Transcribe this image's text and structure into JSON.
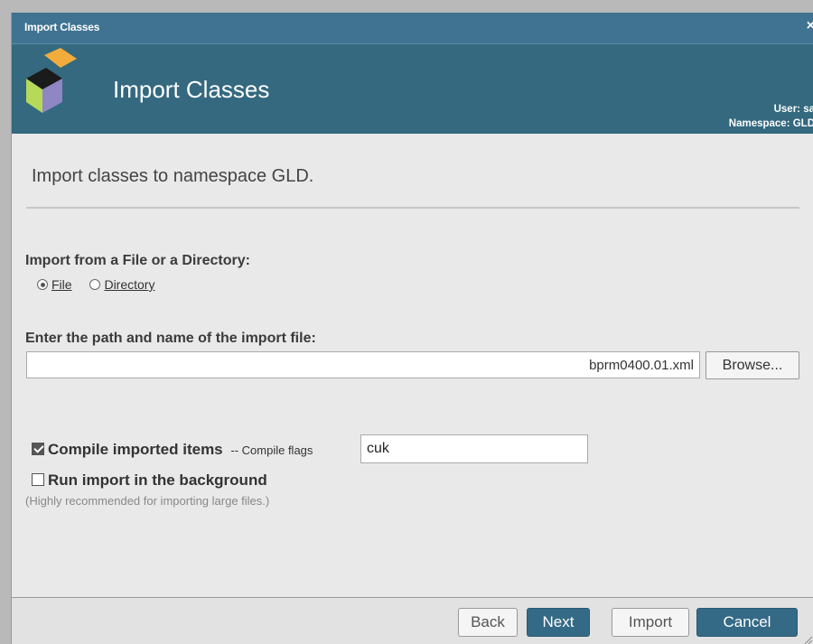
{
  "window": {
    "title": "Import Classes",
    "close_glyph": "×"
  },
  "header": {
    "heading": "Import Classes",
    "user_line": "User:  sa",
    "namespace_line": "Namespace: GLD",
    "logo_icon": "cube-logo-icon"
  },
  "intro": "Import classes to namespace GLD.",
  "source": {
    "label": "Import from a File or a Directory:",
    "options": [
      {
        "label": "File",
        "checked": true
      },
      {
        "label": "Directory",
        "checked": false
      }
    ]
  },
  "path": {
    "label": "Enter the path and name of the import file:",
    "value": "bprm0400.01.xml",
    "browse_label": "Browse..."
  },
  "compile": {
    "label": "Compile imported items",
    "checked": true,
    "flags_label": "-- Compile flags",
    "flags_value": "cuk"
  },
  "background": {
    "label": "Run import in the background",
    "checked": false,
    "hint": "(Highly recommended for importing large files.)"
  },
  "footer": {
    "back_label": "Back",
    "next_label": "Next",
    "import_label": "Import",
    "cancel_label": "Cancel"
  },
  "colors": {
    "titlebar": "#3f7391",
    "header": "#34697f",
    "primary_button": "#356a86"
  }
}
